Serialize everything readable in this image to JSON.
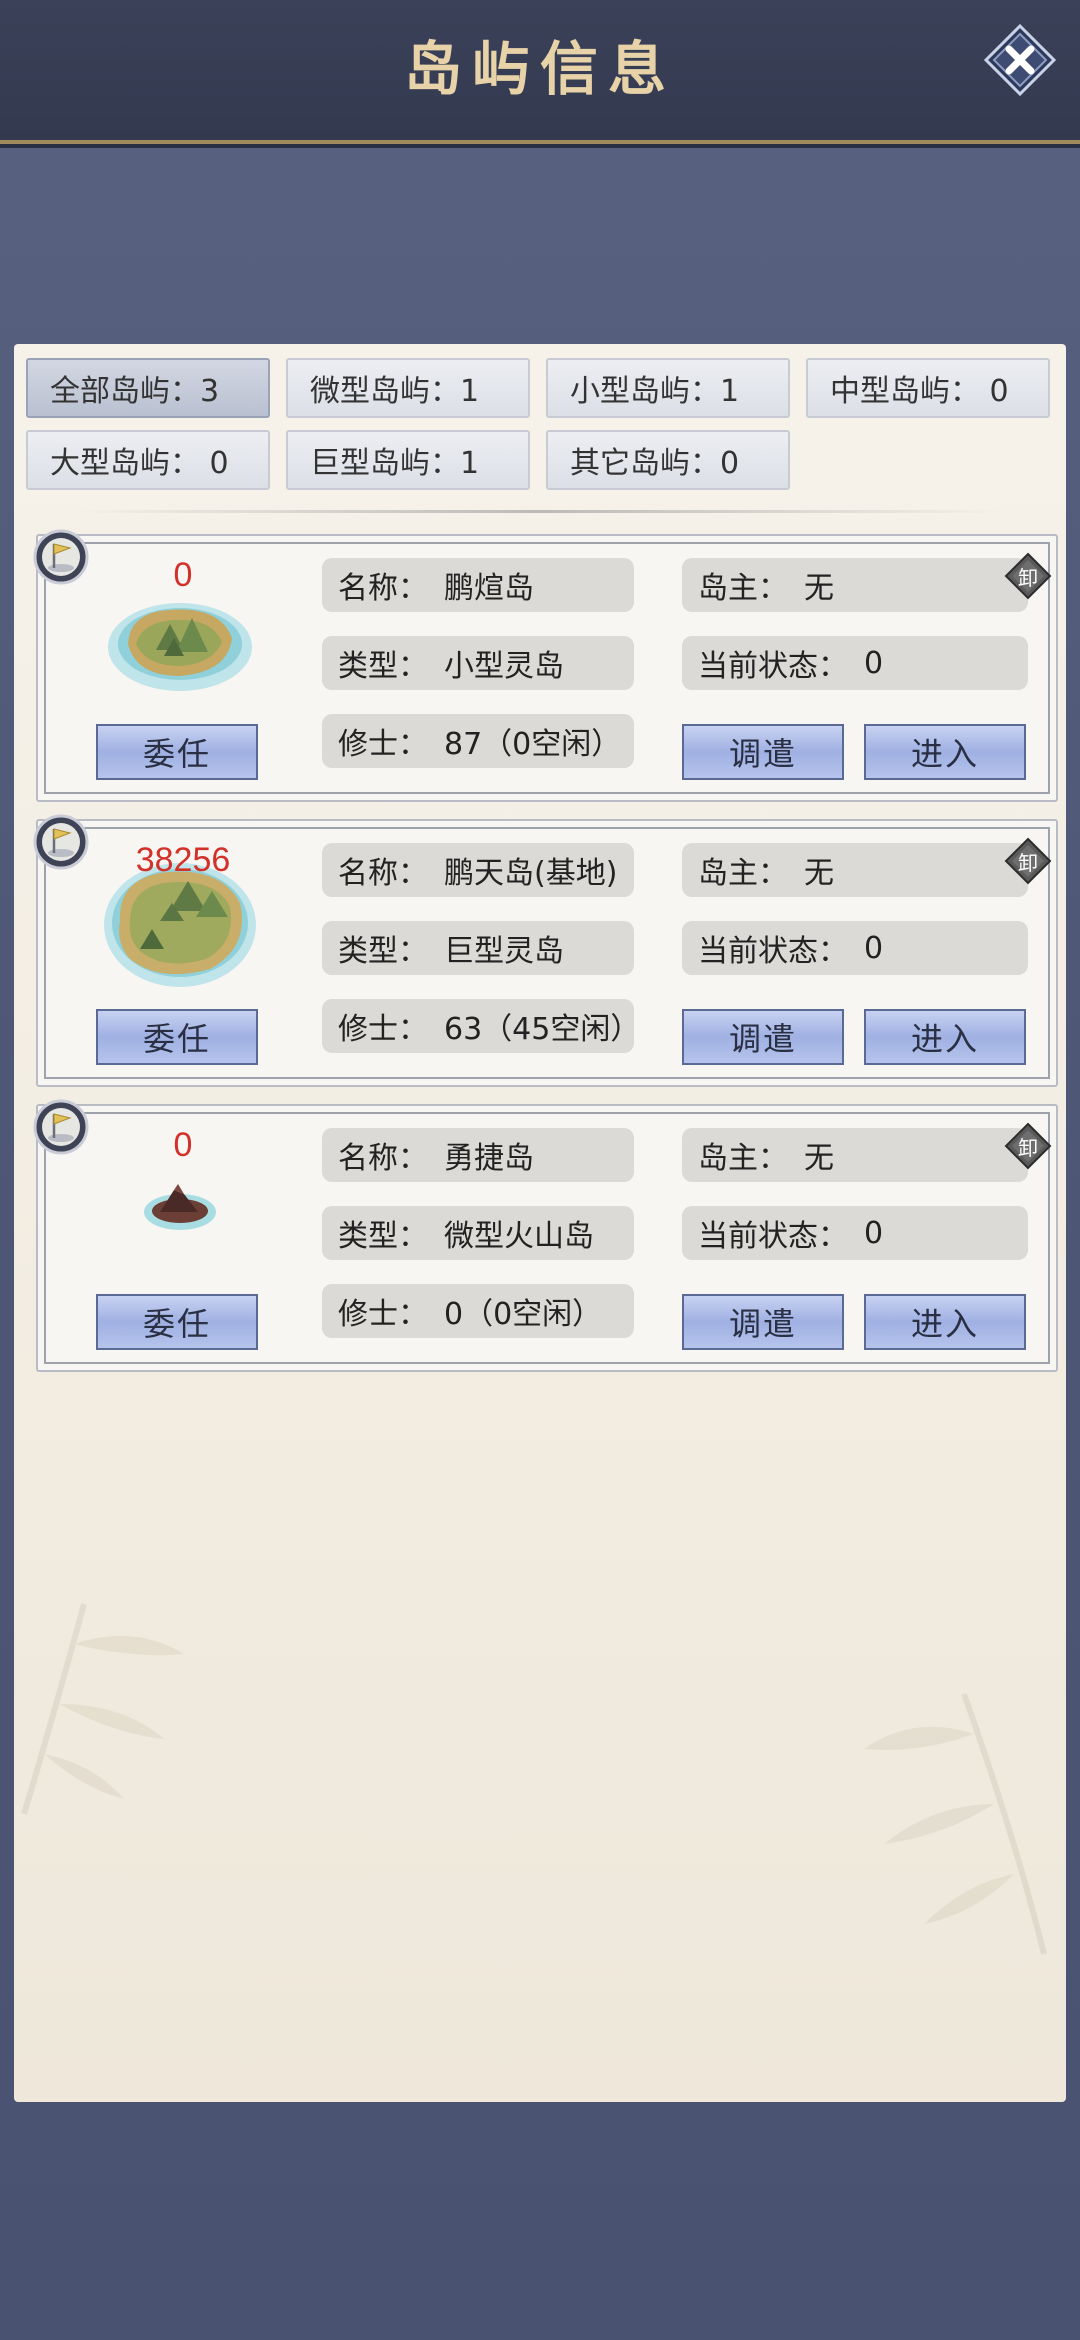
{
  "header": {
    "title": "岛屿信息"
  },
  "tabs": [
    {
      "label": "全部岛屿：3"
    },
    {
      "label": "微型岛屿：1"
    },
    {
      "label": "小型岛屿：1"
    },
    {
      "label": "中型岛屿： 0"
    },
    {
      "label": "大型岛屿： 0"
    },
    {
      "label": "巨型岛屿：1"
    },
    {
      "label": "其它岛屿：0"
    }
  ],
  "islands": [
    {
      "power": "0",
      "name_label": "名称：",
      "name": "鹏煊岛",
      "owner_label": "岛主：",
      "owner": "无",
      "type_label": "类型：",
      "type": "小型灵岛",
      "status_label": "当前状态：",
      "status": "0",
      "cultivators_label": "修士：",
      "cultivators": "87（0空闲）",
      "appoint": "委任",
      "dispatch": "调遣",
      "enter": "进入",
      "unload": "卸"
    },
    {
      "power": "38256",
      "name_label": "名称：",
      "name": "鹏天岛(基地)",
      "owner_label": "岛主：",
      "owner": "无",
      "type_label": "类型：",
      "type": "巨型灵岛",
      "status_label": "当前状态：",
      "status": "0",
      "cultivators_label": "修士：",
      "cultivators": "63（45空闲）",
      "appoint": "委任",
      "dispatch": "调遣",
      "enter": "进入",
      "unload": "卸"
    },
    {
      "power": "0",
      "name_label": "名称：",
      "name": "勇捷岛",
      "owner_label": "岛主：",
      "owner": "无",
      "type_label": "类型：",
      "type": "微型火山岛",
      "status_label": "当前状态：",
      "status": "0",
      "cultivators_label": "修士：",
      "cultivators": "0（0空闲）",
      "appoint": "委任",
      "dispatch": "调遣",
      "enter": "进入",
      "unload": "卸"
    }
  ],
  "colors": {
    "header_bg": "#353c52",
    "title_gold": "#e8d2a8",
    "power_red": "#d4302a",
    "button_blue": "#aebcea"
  }
}
